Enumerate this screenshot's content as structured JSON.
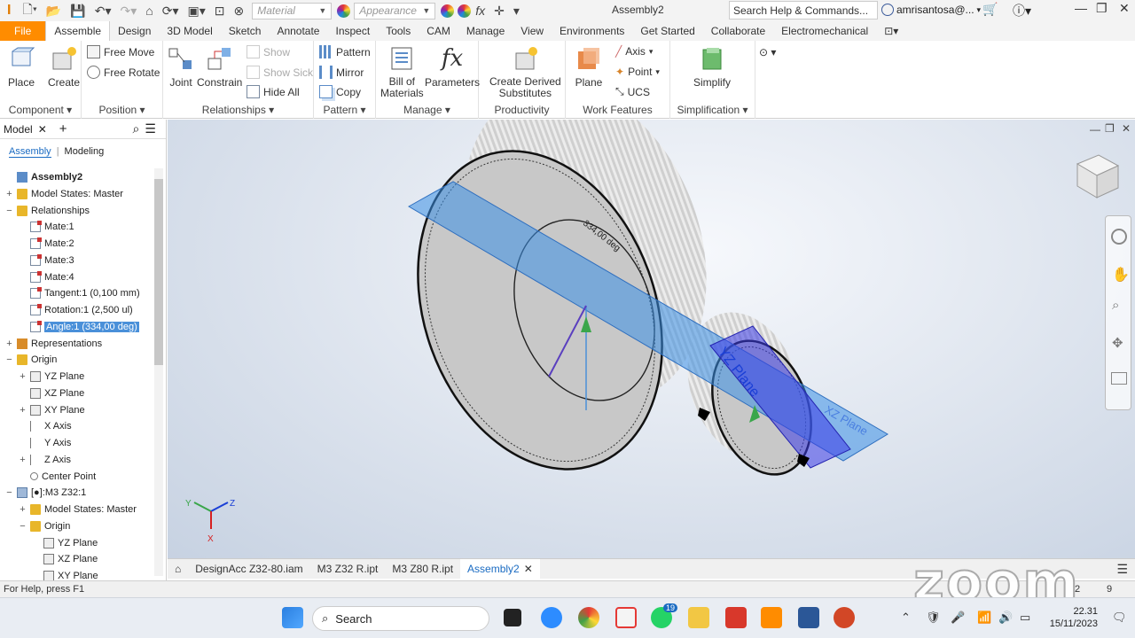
{
  "app": {
    "title": "Assembly2"
  },
  "toolbar": {
    "material_placeholder": "Material",
    "appearance_placeholder": "Appearance",
    "search_placeholder": "Search Help & Commands...",
    "user": "amrisantosa@..."
  },
  "tabs": [
    "File",
    "Assemble",
    "Design",
    "3D Model",
    "Sketch",
    "Annotate",
    "Inspect",
    "Tools",
    "CAM",
    "Manage",
    "View",
    "Environments",
    "Get Started",
    "Collaborate",
    "Electromechanical"
  ],
  "ribbon": {
    "component": {
      "label": "Component",
      "place": "Place",
      "create": "Create"
    },
    "position": {
      "label": "Position",
      "free_move": "Free Move",
      "free_rotate": "Free Rotate"
    },
    "relationships": {
      "label": "Relationships",
      "joint": "Joint",
      "constrain": "Constrain",
      "show": "Show",
      "show_sick": "Show Sick",
      "hide_all": "Hide All"
    },
    "pattern": {
      "label": "Pattern",
      "pattern": "Pattern",
      "mirror": "Mirror",
      "copy": "Copy"
    },
    "manage": {
      "label": "Manage",
      "bom_line1": "Bill of",
      "bom_line2": "Materials",
      "parameters": "Parameters"
    },
    "productivity": {
      "label": "Productivity",
      "derived_line1": "Create Derived",
      "derived_line2": "Substitutes"
    },
    "work_features": {
      "label": "Work Features",
      "plane": "Plane",
      "axis": "Axis",
      "point": "Point",
      "ucs": "UCS"
    },
    "simplification": {
      "label": "Simplification",
      "simplify": "Simplify"
    }
  },
  "browser": {
    "title": "Model",
    "subtabs": [
      "Assembly",
      "Modeling"
    ],
    "tree": [
      {
        "label": "Assembly2",
        "icon": "assembly-icon",
        "depth": 0,
        "expander": ""
      },
      {
        "label": "Model States: Master",
        "icon": "folder-icon",
        "depth": 0,
        "expander": "+"
      },
      {
        "label": "Relationships",
        "icon": "folder-icon",
        "depth": 0,
        "expander": "−"
      },
      {
        "label": "Mate:1",
        "icon": "mate-icon",
        "depth": 1,
        "expander": ""
      },
      {
        "label": "Mate:2",
        "icon": "mate-icon",
        "depth": 1,
        "expander": ""
      },
      {
        "label": "Mate:3",
        "icon": "mate-icon",
        "depth": 1,
        "expander": ""
      },
      {
        "label": "Mate:4",
        "icon": "mate-icon",
        "depth": 1,
        "expander": ""
      },
      {
        "label": "Tangent:1 (0,100 mm)",
        "icon": "tangent-icon",
        "depth": 1,
        "expander": ""
      },
      {
        "label": "Rotation:1 (2,500 ul)",
        "icon": "rotation-icon",
        "depth": 1,
        "expander": ""
      },
      {
        "label": "Angle:1 (334,00 deg)",
        "icon": "angle-icon",
        "depth": 1,
        "expander": "",
        "selected": true
      },
      {
        "label": "Representations",
        "icon": "representations-icon",
        "depth": 0,
        "expander": "+"
      },
      {
        "label": "Origin",
        "icon": "folder-icon",
        "depth": 0,
        "expander": "−"
      },
      {
        "label": "YZ Plane",
        "icon": "plane-icon",
        "depth": 1,
        "expander": "+"
      },
      {
        "label": "XZ Plane",
        "icon": "plane-icon",
        "depth": 1,
        "expander": ""
      },
      {
        "label": "XY Plane",
        "icon": "plane-icon",
        "depth": 1,
        "expander": "+"
      },
      {
        "label": "X Axis",
        "icon": "axis-icon",
        "depth": 1,
        "expander": ""
      },
      {
        "label": "Y Axis",
        "icon": "axis-icon",
        "depth": 1,
        "expander": ""
      },
      {
        "label": "Z Axis",
        "icon": "axis-icon",
        "depth": 1,
        "expander": "+"
      },
      {
        "label": "Center Point",
        "icon": "point-icon",
        "depth": 1,
        "expander": ""
      },
      {
        "label": "[●]:M3 Z32:1",
        "icon": "part-icon",
        "depth": 0,
        "expander": "−"
      },
      {
        "label": "Model States: Master",
        "icon": "folder-icon",
        "depth": 1,
        "expander": "+"
      },
      {
        "label": "Origin",
        "icon": "folder-icon",
        "depth": 1,
        "expander": "−"
      },
      {
        "label": "YZ Plane",
        "icon": "plane-icon",
        "depth": 2,
        "expander": ""
      },
      {
        "label": "XZ Plane",
        "icon": "plane-icon",
        "depth": 2,
        "expander": ""
      },
      {
        "label": "XY Plane",
        "icon": "plane-icon",
        "depth": 2,
        "expander": ""
      }
    ]
  },
  "viewport": {
    "angle_label": "334,00 deg",
    "plane_label_1": "YZ Plane",
    "plane_label_2": "XZ Plane",
    "triad": {
      "x": "X",
      "y": "Y",
      "z": "Z"
    }
  },
  "doc_tabs": [
    "DesignAcc Z32-80.iam",
    "M3 Z32 R.ipt",
    "M3 Z80 R.ipt",
    "Assembly2"
  ],
  "status": {
    "help": "For Help, press F1",
    "n1": "2",
    "n2": "9"
  },
  "watermark": "zoom",
  "taskbar": {
    "search": "Search",
    "time": "22.31",
    "date": "15/11/2023",
    "whatsapp_badge": "19"
  },
  "colors": {
    "file_tab": "#ff8c00",
    "accent": "#1a6bc2",
    "plane_fill": "#3b8fe6",
    "selection": "#4a90d9"
  }
}
